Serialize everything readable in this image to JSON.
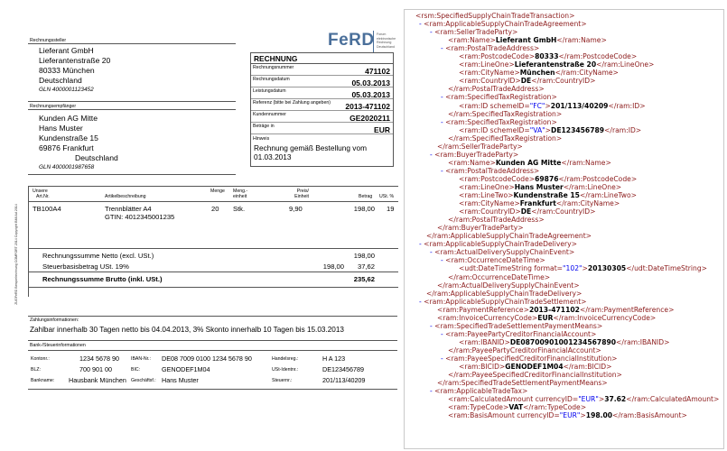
{
  "invoice": {
    "seller_label": "Rechnungssteller",
    "seller": [
      "Lieferant GmbH",
      "Lieferantenstraße 20",
      "80333 München",
      "Deutschland"
    ],
    "seller_gln": "GLN 4000001123452",
    "logo": {
      "text": "FeRD",
      "tagline": [
        "Forum",
        "elektronische",
        "Rechnung",
        "Deutschland"
      ]
    },
    "title": "RECHNUNG",
    "fields": [
      {
        "label": "Rechnungsnummer",
        "value": "471102"
      },
      {
        "label": "Rechnungsdatum",
        "value": "05.03.2013"
      },
      {
        "label": "Leistungsdatum",
        "value": "05.03.2013"
      },
      {
        "label": "Referenz (bitte bei Zahlung angeben)",
        "value": "2013-471102"
      },
      {
        "label": "Kundennummer",
        "value": "GE2020211"
      },
      {
        "label": "Beträge in",
        "value": "EUR"
      }
    ],
    "note_label": "Hinweis",
    "note": [
      "Rechnung gemäß Bestellung vom",
      "01.03.2013"
    ],
    "buyer_label": "Rechnungsempfänger",
    "buyer": [
      "Kunden AG Mitte",
      "Hans Muster",
      "Kundenstraße 15",
      "69876 Frankfurt",
      "Deutschland"
    ],
    "buyer_gln": "GLN 4000001987658",
    "side_text": "ZUGFeRD Beispielrechnung COMFORT 2014 Copyright BMI Ad 2014",
    "table_headers": {
      "art_nr": [
        "Unsere",
        "Art.Nr."
      ],
      "desc": "Artikelbeschreibung",
      "qty": "Menge",
      "unit": [
        "Meng.-",
        "einheit"
      ],
      "price": [
        "Preis/",
        "Einheit"
      ],
      "amount": "Betrag",
      "vat": "USt. %"
    },
    "line_item": {
      "art_nr": "TB100A4",
      "desc": [
        "Trennblätter A4",
        "GTIN: 4012345001235"
      ],
      "qty": "20",
      "unit": "Stk.",
      "price": "9,90",
      "amount": "198,00",
      "vat": "19"
    },
    "totals": {
      "net_label": "Rechnungssumme Netto (excl. USt.)",
      "net_value": "198,00",
      "tax_label": "Steuerbasisbetrag USt. 19%",
      "tax_base": "198,00",
      "tax_value": "37,62",
      "gross_label": "Rechnungssumme Brutto (inkl. USt.)",
      "gross_value": "235,62"
    },
    "payment_label": "Zahlungsinformationen:",
    "payment_text": "Zahlbar innerhalb 30 Tagen netto bis 04.04.2013, 3% Skonto innerhalb 10 Tagen bis 15.03.2013",
    "bank_label": "Bank-/Steuerinformationen",
    "bank": {
      "konto_label": "Kontonr.:",
      "konto": "1234 5678 90",
      "iban_label": "IBAN-Nr.:",
      "iban": "DE08 7009 0100 1234 5678 90",
      "hr_label": "Handelsreg.:",
      "hr": "H A 123",
      "blz_label": "BLZ:",
      "blz": "700 901 00",
      "bic_label": "BIC:",
      "bic": "GENODEF1M04",
      "ustid_label": "USt-Identnr.:",
      "ustid": "DE123456789",
      "bankname_label": "Bankname:",
      "bankname": "Hausbank München",
      "gf_label": "Geschäftsf.:",
      "gf": "Hans Muster",
      "stnr_label": "Steuernr.:",
      "stnr": "201/113/40209"
    }
  },
  "xml": [
    {
      "i": 0,
      "t": "<rsm:SpecifiedSupplyChainTradeTransaction>"
    },
    {
      "i": 1,
      "m": "-",
      "t": "<ram:ApplicableSupplyChainTradeAgreement>"
    },
    {
      "i": 2,
      "m": "-",
      "t": "<ram:SellerTradeParty>"
    },
    {
      "i": 3,
      "o": "<ram:Name>",
      "v": "Lieferant GmbH",
      "c": "</ram:Name>"
    },
    {
      "i": 3,
      "m": "-",
      "t": "<ram:PostalTradeAddress>"
    },
    {
      "i": 4,
      "o": "<ram:PostcodeCode>",
      "v": "80333",
      "c": "</ram:PostcodeCode>"
    },
    {
      "i": 4,
      "o": "<ram:LineOne>",
      "v": "Lieferantenstraße 20",
      "c": "</ram:LineOne>"
    },
    {
      "i": 4,
      "o": "<ram:CityName>",
      "v": "München",
      "c": "</ram:CityName>"
    },
    {
      "i": 4,
      "o": "<ram:CountryID>",
      "v": "DE",
      "c": "</ram:CountryID>"
    },
    {
      "i": 3,
      "t": "</ram:PostalTradeAddress>"
    },
    {
      "i": 3,
      "m": "-",
      "t": "<ram:SpecifiedTaxRegistration>"
    },
    {
      "i": 4,
      "o": "<ram:ID ",
      "an": "schemeID",
      "av": "\"FC\"",
      "ot": ">",
      "v": "201/113/40209",
      "c": "</ram:ID>"
    },
    {
      "i": 3,
      "t": "</ram:SpecifiedTaxRegistration>"
    },
    {
      "i": 3,
      "m": "-",
      "t": "<ram:SpecifiedTaxRegistration>"
    },
    {
      "i": 4,
      "o": "<ram:ID ",
      "an": "schemeID",
      "av": "\"VA\"",
      "ot": ">",
      "v": "DE123456789",
      "c": "</ram:ID>"
    },
    {
      "i": 3,
      "t": "</ram:SpecifiedTaxRegistration>"
    },
    {
      "i": 2,
      "t": "</ram:SellerTradeParty>"
    },
    {
      "i": 2,
      "m": "-",
      "t": "<ram:BuyerTradeParty>"
    },
    {
      "i": 3,
      "o": "<ram:Name>",
      "v": "Kunden AG Mitte",
      "c": "</ram:Name>"
    },
    {
      "i": 3,
      "m": "-",
      "t": "<ram:PostalTradeAddress>"
    },
    {
      "i": 4,
      "o": "<ram:PostcodeCode>",
      "v": "69876",
      "c": "</ram:PostcodeCode>"
    },
    {
      "i": 4,
      "o": "<ram:LineOne>",
      "v": "Hans Muster",
      "c": "</ram:LineOne>"
    },
    {
      "i": 4,
      "o": "<ram:LineTwo>",
      "v": "Kundenstraße 15",
      "c": "</ram:LineTwo>"
    },
    {
      "i": 4,
      "o": "<ram:CityName>",
      "v": "Frankfurt",
      "c": "</ram:CityName>"
    },
    {
      "i": 4,
      "o": "<ram:CountryID>",
      "v": "DE",
      "c": "</ram:CountryID>"
    },
    {
      "i": 3,
      "t": "</ram:PostalTradeAddress>"
    },
    {
      "i": 2,
      "t": "</ram:BuyerTradeParty>"
    },
    {
      "i": 1,
      "t": "</ram:ApplicableSupplyChainTradeAgreement>"
    },
    {
      "i": 1,
      "m": "-",
      "t": "<ram:ApplicableSupplyChainTradeDelivery>"
    },
    {
      "i": 2,
      "m": "-",
      "t": "<ram:ActualDeliverySupplyChainEvent>"
    },
    {
      "i": 3,
      "m": "-",
      "t": "<ram:OccurrenceDateTime>"
    },
    {
      "i": 4,
      "o": "<udt:DateTimeString ",
      "an": "format",
      "av": "\"102\"",
      "ot": ">",
      "v": "20130305",
      "c": "</udt:DateTimeString>"
    },
    {
      "i": 3,
      "t": "</ram:OccurrenceDateTime>"
    },
    {
      "i": 2,
      "t": "</ram:ActualDeliverySupplyChainEvent>"
    },
    {
      "i": 1,
      "t": "</ram:ApplicableSupplyChainTradeDelivery>"
    },
    {
      "i": 1,
      "m": "-",
      "t": "<ram:ApplicableSupplyChainTradeSettlement>"
    },
    {
      "i": 2,
      "o": "<ram:PaymentReference>",
      "v": "2013-471102",
      "c": "</ram:PaymentReference>"
    },
    {
      "i": 2,
      "o": "<ram:InvoiceCurrencyCode>",
      "v": "EUR",
      "c": "</ram:InvoiceCurrencyCode>"
    },
    {
      "i": 2,
      "m": "-",
      "t": "<ram:SpecifiedTradeSettlementPaymentMeans>"
    },
    {
      "i": 3,
      "m": "-",
      "t": "<ram:PayeePartyCreditorFinancialAccount>"
    },
    {
      "i": 4,
      "o": "<ram:IBANID>",
      "v": "DE08700901001234567890",
      "c": "</ram:IBANID>"
    },
    {
      "i": 3,
      "t": "</ram:PayeePartyCreditorFinancialAccount>"
    },
    {
      "i": 3,
      "m": "-",
      "t": "<ram:PayeeSpecifiedCreditorFinancialInstitution>"
    },
    {
      "i": 4,
      "o": "<ram:BICID>",
      "v": "GENODEF1M04",
      "c": "</ram:BICID>"
    },
    {
      "i": 3,
      "t": "</ram:PayeeSpecifiedCreditorFinancialInstitution>"
    },
    {
      "i": 2,
      "t": "</ram:SpecifiedTradeSettlementPaymentMeans>"
    },
    {
      "i": 2,
      "m": "-",
      "t": "<ram:ApplicableTradeTax>"
    },
    {
      "i": 3,
      "o": "<ram:CalculatedAmount ",
      "an": "currencyID",
      "av": "\"EUR\"",
      "ot": ">",
      "v": "37.62",
      "c": "</ram:CalculatedAmount>"
    },
    {
      "i": 3,
      "o": "<ram:TypeCode>",
      "v": "VAT",
      "c": "</ram:TypeCode>"
    },
    {
      "i": 3,
      "o": "<ram:BasisAmount ",
      "an": "currencyID",
      "av": "\"EUR\"",
      "ot": ">",
      "v": "198.00",
      "c": "</ram:BasisAmount>"
    }
  ]
}
